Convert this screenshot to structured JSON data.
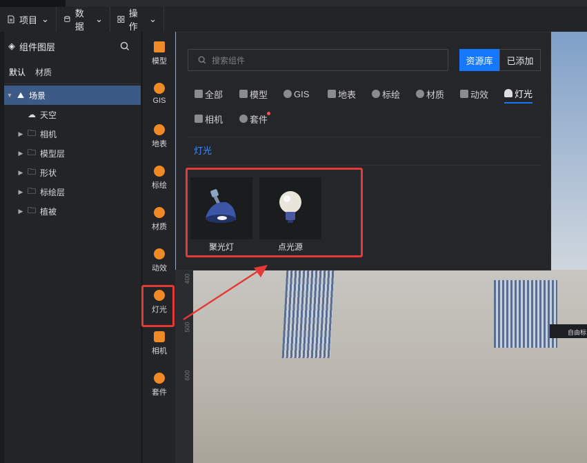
{
  "topbar": {
    "menus": [
      {
        "label": "项目",
        "icon": "file-icon"
      },
      {
        "label": "数据",
        "icon": "database-icon"
      },
      {
        "label": "操作",
        "icon": "grid-icon"
      }
    ]
  },
  "layers": {
    "title": "组件图层",
    "tabs": [
      "默认",
      "材质"
    ],
    "tree": [
      {
        "label": "场景",
        "icon": "scene-icon",
        "expanded": true
      },
      {
        "label": "天空",
        "icon": "sky-icon"
      },
      {
        "label": "相机",
        "icon": "folder-icon"
      },
      {
        "label": "模型层",
        "icon": "folder-icon"
      },
      {
        "label": "形状",
        "icon": "folder-icon"
      },
      {
        "label": "标绘层",
        "icon": "folder-icon"
      },
      {
        "label": "植被",
        "icon": "folder-icon"
      }
    ]
  },
  "iconbar": {
    "items": [
      {
        "label": "模型",
        "icon": "model-icon"
      },
      {
        "label": "GIS",
        "icon": "gis-icon"
      },
      {
        "label": "地表",
        "icon": "terrain-icon"
      },
      {
        "label": "标绘",
        "icon": "marker-icon"
      },
      {
        "label": "材质",
        "icon": "material-icon"
      },
      {
        "label": "动效",
        "icon": "effect-icon"
      },
      {
        "label": "灯光",
        "icon": "light-icon"
      },
      {
        "label": "相机",
        "icon": "camera-icon"
      },
      {
        "label": "套件",
        "icon": "kit-icon"
      }
    ]
  },
  "popup": {
    "search_placeholder": "搜索组件",
    "btn_library": "资源库",
    "btn_added": "已添加",
    "categories": [
      "全部",
      "模型",
      "GIS",
      "地表",
      "标绘",
      "材质",
      "动效",
      "灯光",
      "相机",
      "套件"
    ],
    "active_category": "灯光",
    "section_title": "灯光",
    "items": [
      {
        "label": "聚光灯",
        "icon": "spotlight-icon"
      },
      {
        "label": "点光源",
        "icon": "bulb-icon"
      }
    ]
  },
  "viewport": {
    "ruler_labels": [
      "400",
      "500",
      "600"
    ],
    "tag_text": "自由标"
  },
  "colors": {
    "accent": "#1677ff",
    "highlight": "#e53935",
    "icon_orange": "#f08a24",
    "selected_row": "#3b5a85"
  }
}
